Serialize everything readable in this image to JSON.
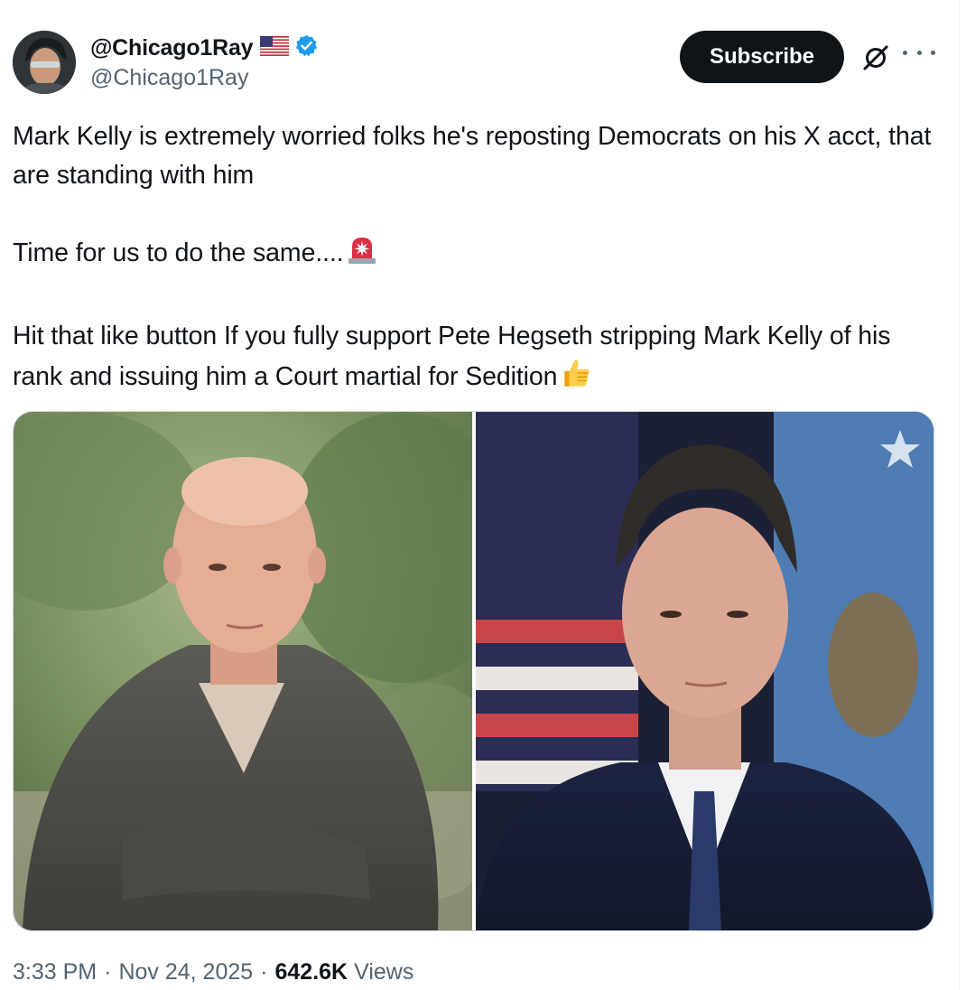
{
  "author": {
    "display_name": "@Chicago1Ray",
    "handle": "@Chicago1Ray",
    "flag_icon": "us-flag-icon",
    "verified_icon": "verified-badge-icon",
    "verified_color": "#1d9bf0"
  },
  "actions": {
    "subscribe_label": "Subscribe",
    "grok_icon": "grok-icon",
    "more_icon": "more-icon"
  },
  "tweet": {
    "paragraphs": [
      "Mark Kelly is extremely worried folks he's reposting Democrats on his X acct, that are standing with him",
      "Time for us to do the same....",
      "Hit that like button If you fully support Pete Hegseth stripping Mark Kelly of his rank and issuing him a Court martial for Sedition"
    ],
    "emoji": [
      "rotating-light-emoji",
      "thumbs-up-emoji"
    ]
  },
  "media": [
    "photo-mark-kelly",
    "photo-pete-hegseth"
  ],
  "meta": {
    "time": "3:33 PM",
    "separator": "·",
    "date": "Nov 24, 2025",
    "views_count": "642.6K",
    "views_label": "Views"
  }
}
